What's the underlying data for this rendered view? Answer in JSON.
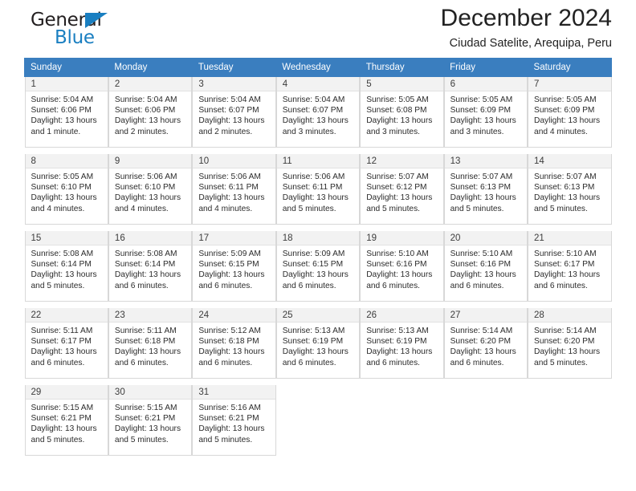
{
  "brand": {
    "name_part1": "General",
    "name_part2": "Blue",
    "triangle_color": "#1a7fc1"
  },
  "header": {
    "month_title": "December 2024",
    "location": "Ciudad Satelite, Arequipa, Peru",
    "accent_color": "#3a7ebf"
  },
  "calendar": {
    "weekday_headers": [
      "Sunday",
      "Monday",
      "Tuesday",
      "Wednesday",
      "Thursday",
      "Friday",
      "Saturday"
    ],
    "weeks": [
      [
        {
          "day": "1",
          "sunrise": "Sunrise: 5:04 AM",
          "sunset": "Sunset: 6:06 PM",
          "daylight1": "Daylight: 13 hours",
          "daylight2": "and 1 minute."
        },
        {
          "day": "2",
          "sunrise": "Sunrise: 5:04 AM",
          "sunset": "Sunset: 6:06 PM",
          "daylight1": "Daylight: 13 hours",
          "daylight2": "and 2 minutes."
        },
        {
          "day": "3",
          "sunrise": "Sunrise: 5:04 AM",
          "sunset": "Sunset: 6:07 PM",
          "daylight1": "Daylight: 13 hours",
          "daylight2": "and 2 minutes."
        },
        {
          "day": "4",
          "sunrise": "Sunrise: 5:04 AM",
          "sunset": "Sunset: 6:07 PM",
          "daylight1": "Daylight: 13 hours",
          "daylight2": "and 3 minutes."
        },
        {
          "day": "5",
          "sunrise": "Sunrise: 5:05 AM",
          "sunset": "Sunset: 6:08 PM",
          "daylight1": "Daylight: 13 hours",
          "daylight2": "and 3 minutes."
        },
        {
          "day": "6",
          "sunrise": "Sunrise: 5:05 AM",
          "sunset": "Sunset: 6:09 PM",
          "daylight1": "Daylight: 13 hours",
          "daylight2": "and 3 minutes."
        },
        {
          "day": "7",
          "sunrise": "Sunrise: 5:05 AM",
          "sunset": "Sunset: 6:09 PM",
          "daylight1": "Daylight: 13 hours",
          "daylight2": "and 4 minutes."
        }
      ],
      [
        {
          "day": "8",
          "sunrise": "Sunrise: 5:05 AM",
          "sunset": "Sunset: 6:10 PM",
          "daylight1": "Daylight: 13 hours",
          "daylight2": "and 4 minutes."
        },
        {
          "day": "9",
          "sunrise": "Sunrise: 5:06 AM",
          "sunset": "Sunset: 6:10 PM",
          "daylight1": "Daylight: 13 hours",
          "daylight2": "and 4 minutes."
        },
        {
          "day": "10",
          "sunrise": "Sunrise: 5:06 AM",
          "sunset": "Sunset: 6:11 PM",
          "daylight1": "Daylight: 13 hours",
          "daylight2": "and 4 minutes."
        },
        {
          "day": "11",
          "sunrise": "Sunrise: 5:06 AM",
          "sunset": "Sunset: 6:11 PM",
          "daylight1": "Daylight: 13 hours",
          "daylight2": "and 5 minutes."
        },
        {
          "day": "12",
          "sunrise": "Sunrise: 5:07 AM",
          "sunset": "Sunset: 6:12 PM",
          "daylight1": "Daylight: 13 hours",
          "daylight2": "and 5 minutes."
        },
        {
          "day": "13",
          "sunrise": "Sunrise: 5:07 AM",
          "sunset": "Sunset: 6:13 PM",
          "daylight1": "Daylight: 13 hours",
          "daylight2": "and 5 minutes."
        },
        {
          "day": "14",
          "sunrise": "Sunrise: 5:07 AM",
          "sunset": "Sunset: 6:13 PM",
          "daylight1": "Daylight: 13 hours",
          "daylight2": "and 5 minutes."
        }
      ],
      [
        {
          "day": "15",
          "sunrise": "Sunrise: 5:08 AM",
          "sunset": "Sunset: 6:14 PM",
          "daylight1": "Daylight: 13 hours",
          "daylight2": "and 5 minutes."
        },
        {
          "day": "16",
          "sunrise": "Sunrise: 5:08 AM",
          "sunset": "Sunset: 6:14 PM",
          "daylight1": "Daylight: 13 hours",
          "daylight2": "and 6 minutes."
        },
        {
          "day": "17",
          "sunrise": "Sunrise: 5:09 AM",
          "sunset": "Sunset: 6:15 PM",
          "daylight1": "Daylight: 13 hours",
          "daylight2": "and 6 minutes."
        },
        {
          "day": "18",
          "sunrise": "Sunrise: 5:09 AM",
          "sunset": "Sunset: 6:15 PM",
          "daylight1": "Daylight: 13 hours",
          "daylight2": "and 6 minutes."
        },
        {
          "day": "19",
          "sunrise": "Sunrise: 5:10 AM",
          "sunset": "Sunset: 6:16 PM",
          "daylight1": "Daylight: 13 hours",
          "daylight2": "and 6 minutes."
        },
        {
          "day": "20",
          "sunrise": "Sunrise: 5:10 AM",
          "sunset": "Sunset: 6:16 PM",
          "daylight1": "Daylight: 13 hours",
          "daylight2": "and 6 minutes."
        },
        {
          "day": "21",
          "sunrise": "Sunrise: 5:10 AM",
          "sunset": "Sunset: 6:17 PM",
          "daylight1": "Daylight: 13 hours",
          "daylight2": "and 6 minutes."
        }
      ],
      [
        {
          "day": "22",
          "sunrise": "Sunrise: 5:11 AM",
          "sunset": "Sunset: 6:17 PM",
          "daylight1": "Daylight: 13 hours",
          "daylight2": "and 6 minutes."
        },
        {
          "day": "23",
          "sunrise": "Sunrise: 5:11 AM",
          "sunset": "Sunset: 6:18 PM",
          "daylight1": "Daylight: 13 hours",
          "daylight2": "and 6 minutes."
        },
        {
          "day": "24",
          "sunrise": "Sunrise: 5:12 AM",
          "sunset": "Sunset: 6:18 PM",
          "daylight1": "Daylight: 13 hours",
          "daylight2": "and 6 minutes."
        },
        {
          "day": "25",
          "sunrise": "Sunrise: 5:13 AM",
          "sunset": "Sunset: 6:19 PM",
          "daylight1": "Daylight: 13 hours",
          "daylight2": "and 6 minutes."
        },
        {
          "day": "26",
          "sunrise": "Sunrise: 5:13 AM",
          "sunset": "Sunset: 6:19 PM",
          "daylight1": "Daylight: 13 hours",
          "daylight2": "and 6 minutes."
        },
        {
          "day": "27",
          "sunrise": "Sunrise: 5:14 AM",
          "sunset": "Sunset: 6:20 PM",
          "daylight1": "Daylight: 13 hours",
          "daylight2": "and 6 minutes."
        },
        {
          "day": "28",
          "sunrise": "Sunrise: 5:14 AM",
          "sunset": "Sunset: 6:20 PM",
          "daylight1": "Daylight: 13 hours",
          "daylight2": "and 5 minutes."
        }
      ],
      [
        {
          "day": "29",
          "sunrise": "Sunrise: 5:15 AM",
          "sunset": "Sunset: 6:21 PM",
          "daylight1": "Daylight: 13 hours",
          "daylight2": "and 5 minutes."
        },
        {
          "day": "30",
          "sunrise": "Sunrise: 5:15 AM",
          "sunset": "Sunset: 6:21 PM",
          "daylight1": "Daylight: 13 hours",
          "daylight2": "and 5 minutes."
        },
        {
          "day": "31",
          "sunrise": "Sunrise: 5:16 AM",
          "sunset": "Sunset: 6:21 PM",
          "daylight1": "Daylight: 13 hours",
          "daylight2": "and 5 minutes."
        },
        null,
        null,
        null,
        null
      ]
    ]
  }
}
